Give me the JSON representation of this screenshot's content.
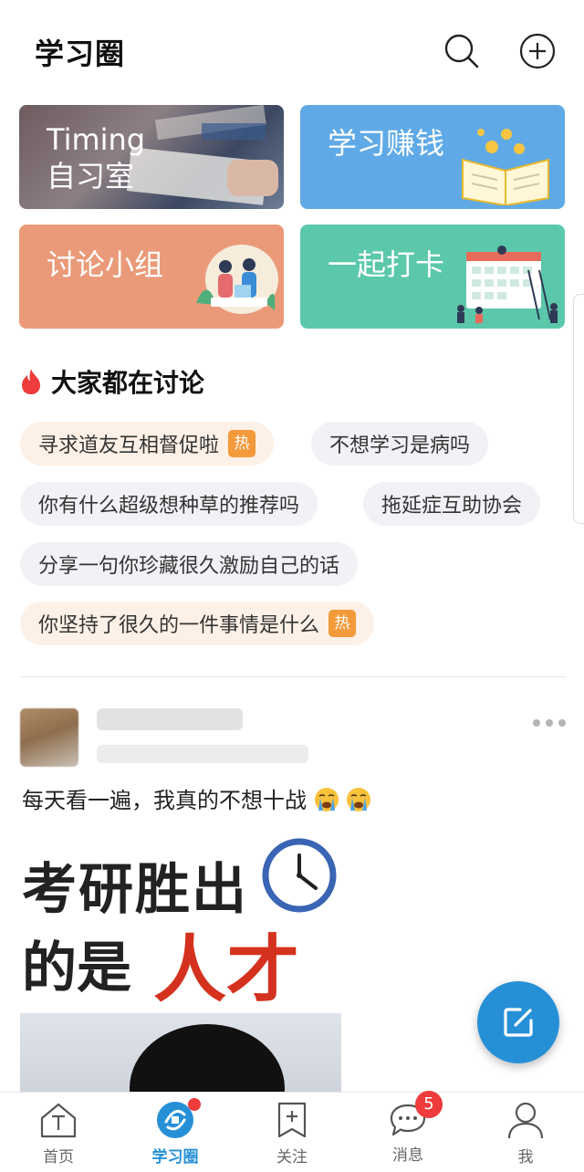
{
  "header": {
    "title": "学习圈"
  },
  "cards": {
    "timing": {
      "line1": "Timing",
      "line2": "自习室"
    },
    "earn": {
      "label": "学习赚钱"
    },
    "group": {
      "label": "讨论小组"
    },
    "checkin": {
      "label": "一起打卡"
    }
  },
  "discussion": {
    "title": "大家都在讨论",
    "hot_label": "热",
    "topics": [
      {
        "text": "寻求道友互相督促啦",
        "hot": true
      },
      {
        "text": "不想学习是病吗",
        "hot": false
      },
      {
        "text": "你有什么超级想种草的推荐吗",
        "hot": false
      },
      {
        "text": "拖延症互助协会",
        "hot": false
      },
      {
        "text": "分享一句你珍藏很久激励自己的话",
        "hot": false
      },
      {
        "text": "你坚持了很久的一件事情是什么",
        "hot": true
      }
    ]
  },
  "post": {
    "text": "每天看一遍，我真的不想十战",
    "emoji": [
      "crying-face",
      "crying-face"
    ],
    "image": {
      "line1": "考研胜出",
      "line2a": "的是",
      "line2b": "人才"
    }
  },
  "bottom_nav": {
    "items": [
      {
        "label": "首页",
        "icon": "home-icon"
      },
      {
        "label": "学习圈",
        "icon": "circle-icon",
        "active": true
      },
      {
        "label": "关注",
        "icon": "follow-icon"
      },
      {
        "label": "消息",
        "icon": "message-icon",
        "badge": "5"
      },
      {
        "label": "我",
        "icon": "profile-icon"
      }
    ]
  },
  "colors": {
    "accent": "#2690d7",
    "hot": "#f39a3a",
    "badge": "#ee3b3b",
    "card_earn": "#5faae6",
    "card_group": "#ea9a78",
    "card_checkin": "#5cc8ab"
  }
}
